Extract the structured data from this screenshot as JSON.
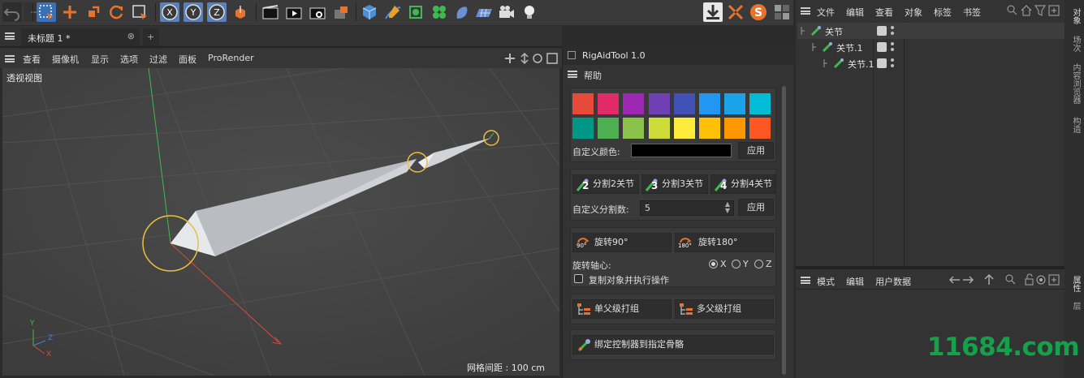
{
  "toolbar": {
    "tools": [
      "undo-icon",
      "redo-icon",
      "select-icon",
      "move-icon",
      "scale-icon",
      "rotate-icon",
      "recent-tools-icon",
      "x-axis-lock-icon",
      "y-axis-lock-icon",
      "z-axis-lock-icon",
      "coordinate-system-icon",
      "render-view-icon",
      "render-to-picture-viewer-icon",
      "render-settings-icon",
      "edit-render-settings-icon",
      "cube-icon",
      "pen-icon",
      "subdivision-surface-icon",
      "cloner-icon",
      "deformer-icon",
      "floor-icon",
      "camera-icon",
      "light-icon"
    ],
    "axis_labels": [
      "X",
      "Y",
      "Z"
    ],
    "colors": {
      "accent_blue": "#3b6fb6",
      "accent_orange": "#e8732a"
    }
  },
  "document": {
    "tab_title": "未标题 1 *",
    "new_tab_label": "+",
    "close_tab_label": "⊗"
  },
  "viewport": {
    "menu": [
      "查看",
      "摄像机",
      "显示",
      "选项",
      "过滤",
      "面板",
      "ProRender"
    ],
    "view_name": "透视视图",
    "grid_spacing": "网格间距 : 100 cm",
    "axis_x": "X",
    "axis_y": "Y",
    "axis_z": "Z"
  },
  "plugin": {
    "title": "RigAidTool 1.0",
    "help_menu": "帮助",
    "swatches": [
      "#e84a3a",
      "#e22a68",
      "#9c27b0",
      "#6f3fb6",
      "#3f51b5",
      "#2196f3",
      "#1aa3e8",
      "#00bcd4",
      "#009688",
      "#4caf50",
      "#8bc34a",
      "#cddc39",
      "#ffeb3b",
      "#ffc107",
      "#ff9800",
      "#ff5722"
    ],
    "custom_color_label": "自定义颜色:",
    "custom_color_value": "#000000",
    "apply_label": "应用",
    "split_buttons": [
      {
        "label": "分割2关节",
        "num": "2"
      },
      {
        "label": "分割3关节",
        "num": "3"
      },
      {
        "label": "分割4关节",
        "num": "4"
      }
    ],
    "custom_split_label": "自定义分割数:",
    "custom_split_value": "5",
    "apply_label_2": "应用",
    "rotate_90": {
      "label": "旋转90°",
      "badge": "90°"
    },
    "rotate_180": {
      "label": "旋转180°",
      "badge": "180°"
    },
    "rotate_axis_label": "旋转轴心:",
    "axes": [
      "X",
      "Y",
      "Z"
    ],
    "axis_selected": "X",
    "copy_label": "复制对象并执行操作",
    "copy_checked": false,
    "group_single": "单父级打组",
    "group_multi": "多父级打组",
    "bind_label": "绑定控制器到指定骨骼"
  },
  "object_manager": {
    "menu": [
      "文件",
      "编辑",
      "查看",
      "对象",
      "标签",
      "书签"
    ],
    "objects": [
      {
        "name": "关节",
        "depth": 0
      },
      {
        "name": "关节.1",
        "depth": 1
      },
      {
        "name": "关节.1",
        "depth": 2
      }
    ]
  },
  "attribute_manager": {
    "menu": [
      "模式",
      "编辑",
      "用户数据"
    ]
  },
  "side_tabs_top": [
    "对象",
    "场次",
    "内容浏览器",
    "构造"
  ],
  "side_tabs_bottom": [
    "属性",
    "层"
  ],
  "watermark": "11684.com"
}
